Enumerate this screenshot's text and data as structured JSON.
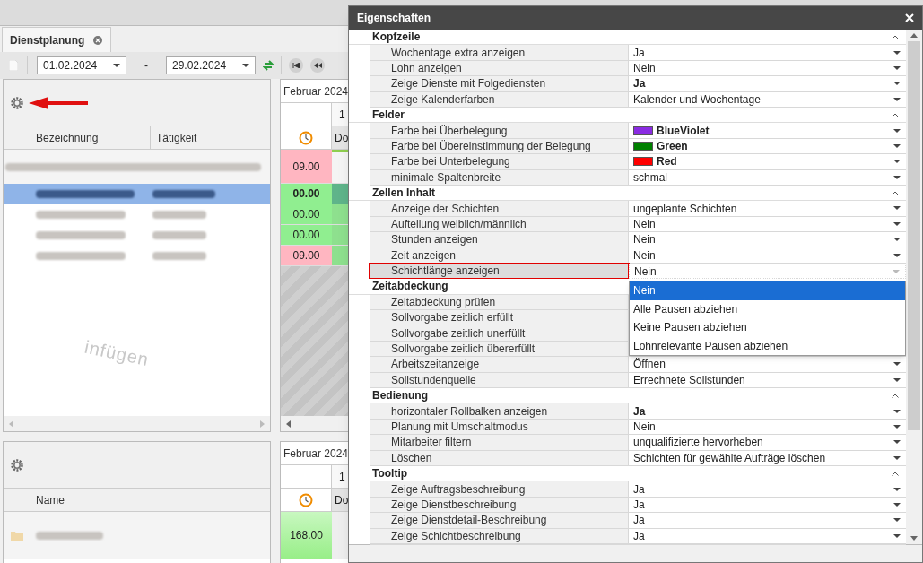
{
  "tab": {
    "label": "Dienstplanung"
  },
  "toolbar": {
    "date_from": "01.02.2024",
    "separator": "-",
    "date_to": "29.02.2024"
  },
  "upper_panel": {
    "columns": [
      "Bezeichnung",
      "Tätigkeit"
    ],
    "month": "Februar 2024",
    "day": "1",
    "weekday": "Do",
    "hint": "infügen",
    "rows": [
      {
        "kind": "group",
        "selected": false,
        "hours": "09.00",
        "color": "#ffb6c1"
      },
      {
        "kind": "item",
        "selected": true,
        "hours": "00.00",
        "color": "#90ee90"
      },
      {
        "kind": "item",
        "selected": false,
        "hours": "00.00",
        "color": "#90ee90"
      },
      {
        "kind": "item",
        "selected": false,
        "hours": "00.00",
        "color": "#90ee90"
      },
      {
        "kind": "item",
        "selected": false,
        "hours": "09.00",
        "color": "#ffb6c1"
      }
    ]
  },
  "lower_panel": {
    "columns": [
      "Name"
    ],
    "month": "Februar 2024",
    "day": "1",
    "weekday": "Do",
    "rows": [
      {
        "hours": "168.00"
      }
    ]
  },
  "dialog": {
    "title": "Eigenschaften",
    "dropdown": {
      "options": [
        {
          "label": "Nein",
          "selected": true
        },
        {
          "label": "Alle Pausen abziehen",
          "selected": false
        },
        {
          "label": "Keine Pausen abziehen",
          "selected": false
        },
        {
          "label": "Lohnrelevante Pausen abziehen",
          "selected": false
        }
      ]
    },
    "sections": [
      {
        "title": "Kopfzeile",
        "rows": [
          {
            "name": "Wochentage extra anzeigen",
            "value": "Ja",
            "selected": false
          },
          {
            "name": "Lohn anzeigen",
            "value": "Nein",
            "selected": false
          },
          {
            "name": "Zeige Dienste mit Folgediensten",
            "value": "Ja",
            "bold": true,
            "selected": false
          },
          {
            "name": "Zeige Kalenderfarben",
            "value": "Kalender und Wochentage",
            "selected": false
          }
        ]
      },
      {
        "title": "Felder",
        "rows": [
          {
            "name": "Farbe bei Überbelegung",
            "value": "BlueViolet",
            "bold": true,
            "selected": false,
            "color": "#8a2be2"
          },
          {
            "name": "Farbe bei Übereinstimmung der Belegung",
            "value": "Green",
            "bold": true,
            "selected": false,
            "color": "#008000"
          },
          {
            "name": "Farbe bei Unterbelegung",
            "value": "Red",
            "bold": true,
            "selected": false,
            "color": "#ff0000"
          },
          {
            "name": "minimale Spaltenbreite",
            "value": "schmal",
            "selected": false
          }
        ]
      },
      {
        "title": "Zellen Inhalt",
        "rows": [
          {
            "name": "Anzeige der Schichten",
            "value": "ungeplante Schichten",
            "selected": false
          },
          {
            "name": "Aufteilung weiblich/männlich",
            "value": "Nein",
            "selected": false
          },
          {
            "name": "Stunden anzeigen",
            "value": "Nein",
            "selected": false
          },
          {
            "name": "Zeit anzeigen",
            "value": "Nein",
            "selected": false
          },
          {
            "name": "Schichtlänge anzeigen",
            "value": "Nein",
            "selected": true
          }
        ]
      },
      {
        "title": "Zeitabdeckung",
        "rows": [
          {
            "name": "Zeitabdeckung prüfen",
            "selected": false
          },
          {
            "name": "Sollvorgabe zeitlich erfüllt",
            "selected": false
          },
          {
            "name": "Sollvorgabe zeitlich unerfüllt",
            "selected": false
          },
          {
            "name": "Sollvorgabe zeitlich übererfüllt",
            "selected": false
          },
          {
            "name": "Arbeitszeitanzeige",
            "value": "Öffnen",
            "selected": false
          },
          {
            "name": "Sollstundenquelle",
            "value": "Errechnete Sollstunden",
            "selected": false
          }
        ]
      },
      {
        "title": "Bedienung",
        "rows": [
          {
            "name": "horizontaler Rollbalken anzeigen",
            "value": "Ja",
            "bold": true,
            "selected": false
          },
          {
            "name": "Planung mit Umschaltmodus",
            "value": "Nein",
            "selected": false
          },
          {
            "name": "Mitarbeiter filtern",
            "value": "unqualifizierte hervorheben",
            "selected": false
          },
          {
            "name": "Löschen",
            "value": "Schichten für gewählte Aufträge löschen",
            "selected": false
          }
        ]
      },
      {
        "title": "Tooltip",
        "rows": [
          {
            "name": "Zeige Auftragsbeschreibung",
            "value": "Ja",
            "selected": false
          },
          {
            "name": "Zeige Dienstbeschreibung",
            "value": "Ja",
            "selected": false
          },
          {
            "name": "Zeige Dienstdetail-Beschreibung",
            "value": "Ja",
            "selected": false
          },
          {
            "name": "Zeige Schichtbeschreibung",
            "value": "Ja",
            "selected": false
          }
        ]
      }
    ]
  }
}
